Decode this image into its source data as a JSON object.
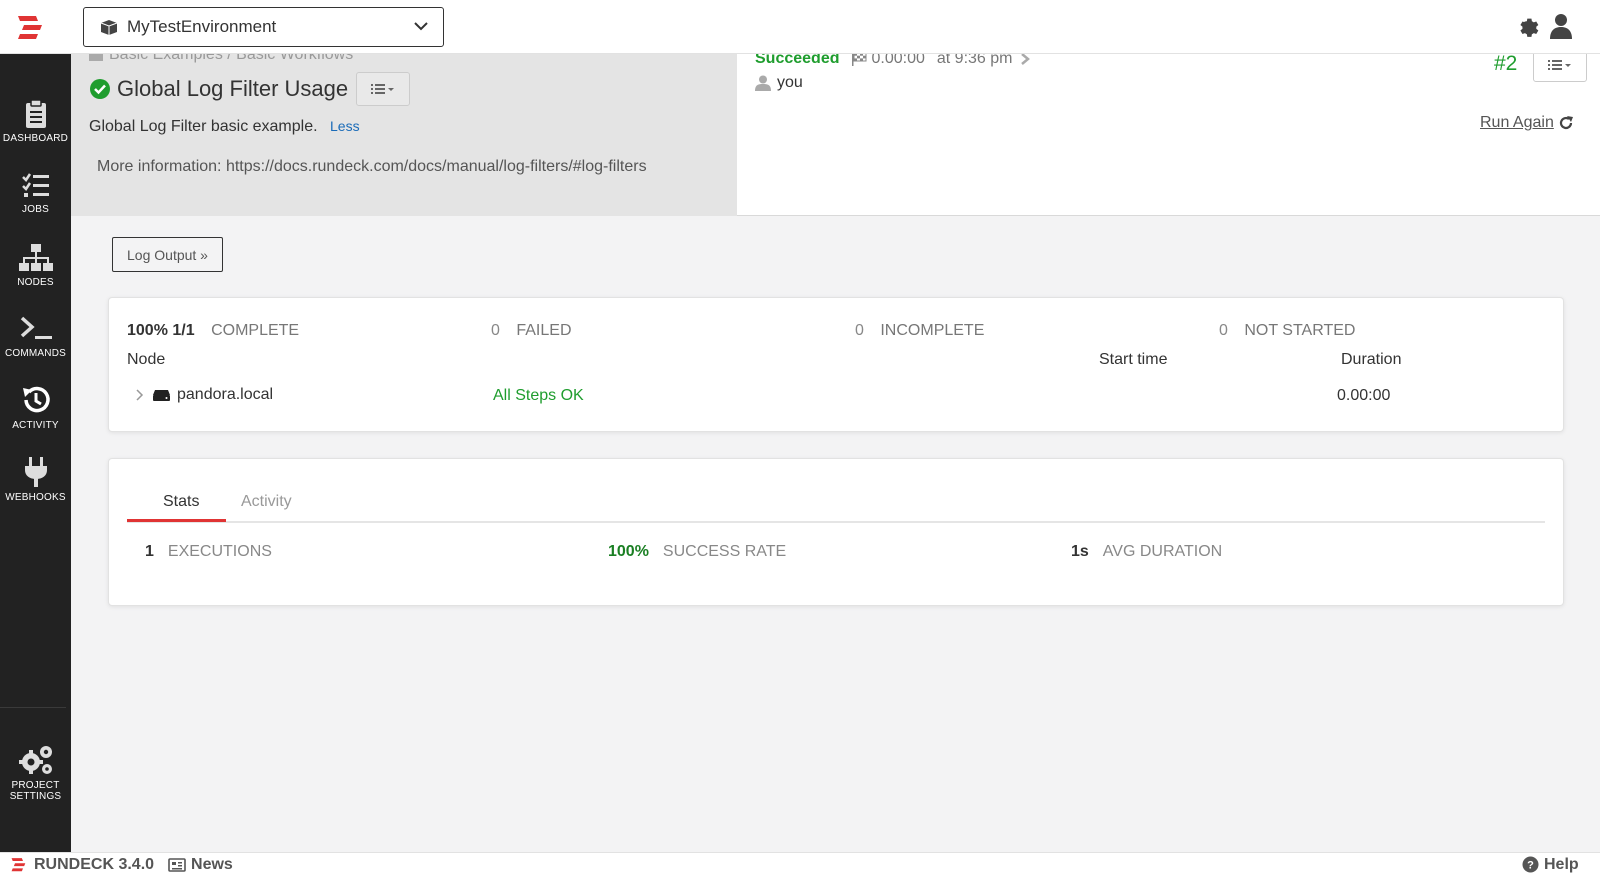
{
  "app": {
    "project_selector": "MyTestEnvironment",
    "version": "RUNDECK 3.4.0",
    "news_label": "News",
    "help_label": "Help"
  },
  "sidebar": {
    "items": [
      {
        "label": "DASHBOARD",
        "icon": "clipboard-icon"
      },
      {
        "label": "JOBS",
        "icon": "list-check-icon"
      },
      {
        "label": "NODES",
        "icon": "sitemap-icon"
      },
      {
        "label": "COMMANDS",
        "icon": "terminal-icon"
      },
      {
        "label": "ACTIVITY",
        "icon": "history-icon"
      },
      {
        "label": "WEBHOOKS",
        "icon": "plug-icon"
      }
    ],
    "settings_label_1": "PROJECT",
    "settings_label_2": "SETTINGS"
  },
  "job": {
    "breadcrumb": "Basic Examples / Basic Workflows",
    "title": "Global Log Filter Usage",
    "description": "Global Log Filter basic example.",
    "less_label": "Less",
    "more_info": "More information: https://docs.rundeck.com/docs/manual/log-filters/#log-filters"
  },
  "execution": {
    "status": "Succeeded",
    "duration": "0.00:00",
    "time": "at 9:36 pm",
    "user": "you",
    "number": "#2",
    "run_again_label": "Run Again",
    "log_output_label": "Log Output »"
  },
  "summary": {
    "complete_pct": "100% 1/1",
    "complete_label": "COMPLETE",
    "failed_count": "0",
    "failed_label": "FAILED",
    "incomplete_count": "0",
    "incomplete_label": "INCOMPLETE",
    "not_started_count": "0",
    "not_started_label": "NOT STARTED",
    "columns": {
      "node": "Node",
      "start_time": "Start time",
      "duration": "Duration"
    },
    "nodes": [
      {
        "name": "pandora.local",
        "status": "All Steps OK",
        "start_time": "",
        "duration": "0.00:00"
      }
    ]
  },
  "stats": {
    "tabs": [
      "Stats",
      "Activity"
    ],
    "active_tab": "Stats",
    "executions_value": "1",
    "executions_label": "EXECUTIONS",
    "success_rate_value": "100%",
    "success_rate_label": "SUCCESS RATE",
    "avg_duration_value": "1s",
    "avg_duration_label": "AVG DURATION"
  },
  "colors": {
    "brand_red": "#e03434",
    "success_green": "#1f9d2e",
    "sidebar_bg": "#222222"
  }
}
